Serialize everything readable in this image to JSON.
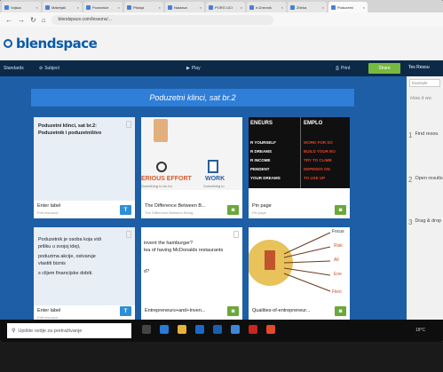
{
  "browser": {
    "tabs": [
      "Vojska",
      "Materijali",
      "Poveznice",
      "Pitanja",
      "Nastava",
      "PORG UCI",
      "e-Dnevnik",
      "Zbirka",
      "Poduzetni"
    ],
    "url": "blendspace.com/lessons/..."
  },
  "brand": {
    "logo": "blendspace"
  },
  "toolbar": {
    "standards": "Standards",
    "subject": "Subject",
    "play": "Play",
    "print": "Print",
    "share": "Share"
  },
  "lesson": {
    "title": "Poduzetni klinci, sat br.2"
  },
  "tiles": [
    {
      "body": "Poduzetni klinci, sat br.2: Poduzetnik i poduzetništvo",
      "title": "Enter label",
      "sub": "Edit resource",
      "badge": "T"
    },
    {
      "title": "The Difference Between B...",
      "sub": "The Difference Between Being...",
      "badge": "cam",
      "poster": [
        "ERIOUS EFFORT",
        "WORK"
      ],
      "poster_sub": [
        "Something to do for",
        "Something to"
      ]
    },
    {
      "title": "Pin page",
      "sub": "Pin page",
      "badge": "cam",
      "left_lines": [
        "ENEURS",
        "R YOURSELF",
        "R DREAMS",
        "R INCOME",
        "PENDENT",
        "YOUR DREAMS"
      ],
      "right_lines": [
        "EMPLO",
        "WORK FOR SO",
        "BUILD YOUR BO",
        "TRY TO CLIMB",
        "DEPENDS ON",
        "TO USE UP"
      ]
    },
    {
      "body_lines": [
        "Poduzetnik je osoba koja vidi",
        "priliku u svojoj ideji,",
        "poduzima akcije, ostvaruje",
        "vlastiti biznis",
        "s ciljem financijske dobiti."
      ],
      "title": "Enter label",
      "sub": "Edit resource",
      "badge": "T"
    },
    {
      "body_lines": [
        "invent the hamburger?",
        "lea of having McDonalds restaurants",
        "d?"
      ],
      "title": "Entrepreneurs+and+Inven...",
      "sub": "",
      "badge": "cam"
    },
    {
      "labels": [
        "Focus",
        "Risk",
        "All",
        "Ene",
        "Flexi"
      ],
      "title": "Qualities-of-entrepreneur...",
      "sub": "",
      "badge": "cam"
    }
  ],
  "side": {
    "head": "Tes Resou",
    "input": "Example",
    "question": "How it wo",
    "steps": [
      {
        "n": "1",
        "text": "Find resou"
      },
      {
        "n": "2",
        "text": "Open results"
      },
      {
        "n": "3",
        "text": "Drag & drop"
      }
    ]
  },
  "taskbar": {
    "search": "Upišite ovdje za pretraživanje",
    "clock": "18°C"
  },
  "colors": {
    "brand": "#0a5aa8",
    "toolbar": "#0c2a48",
    "canvas": "#1d5ea6",
    "share": "#78b940",
    "badge_text": "#2d8fd7",
    "badge_media": "#6aa83a"
  }
}
